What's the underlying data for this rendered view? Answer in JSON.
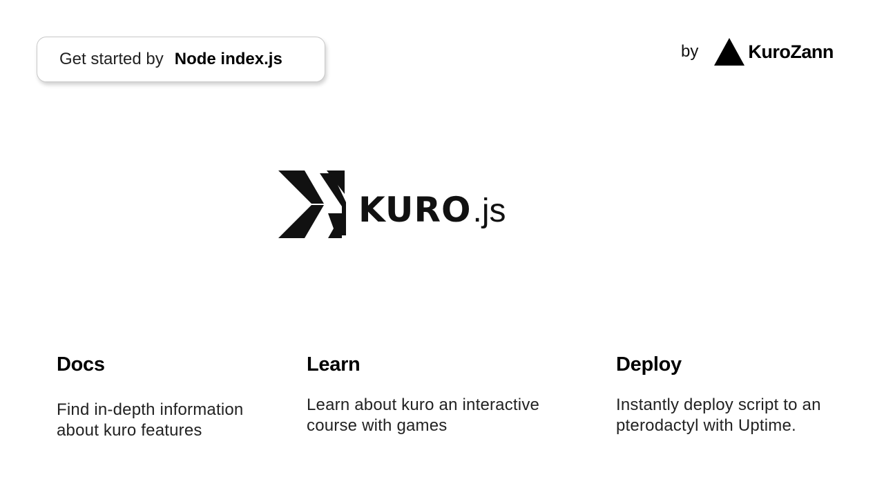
{
  "header": {
    "get_started_prefix": "Get started by",
    "get_started_command": "Node index.js",
    "by_label": "by",
    "brand_name": "KuroZann",
    "brand_icon": "triangle-logo-icon"
  },
  "hero": {
    "logo_icon": "kuro-x-logo-icon",
    "logo_word": "KURO",
    "logo_suffix": ".js"
  },
  "cards": [
    {
      "title": "Docs",
      "description": "Find in-depth information about kuro features"
    },
    {
      "title": "Learn",
      "description": "Learn about kuro an interactive course with games"
    },
    {
      "title": "Deploy",
      "description": "Instantly deploy script to an pterodactyl with Uptime."
    }
  ],
  "colors": {
    "background": "#ffffff",
    "text": "#111111",
    "border": "#c8c8c8"
  }
}
